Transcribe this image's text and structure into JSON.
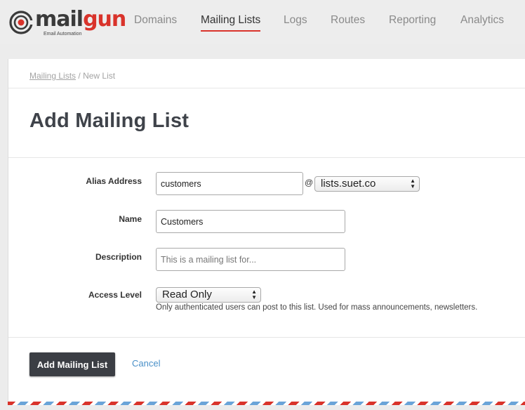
{
  "brand": {
    "name_dark": "mail",
    "name_red": "gun",
    "tagline": "Email Automation",
    "accent_color": "#d9332b"
  },
  "nav": {
    "items": [
      {
        "label": "Domains"
      },
      {
        "label": "Mailing Lists",
        "active": true
      },
      {
        "label": "Logs"
      },
      {
        "label": "Routes"
      },
      {
        "label": "Reporting"
      },
      {
        "label": "Analytics"
      }
    ]
  },
  "breadcrumb": {
    "parent": "Mailing Lists",
    "separator": "/",
    "current": "New List"
  },
  "page": {
    "title": "Add Mailing List"
  },
  "form": {
    "alias": {
      "label": "Alias Address",
      "value": "customers",
      "at_symbol": "@",
      "domain_selected": "lists.suet.co"
    },
    "name": {
      "label": "Name",
      "value": "Customers"
    },
    "description": {
      "label": "Description",
      "placeholder": "This is a mailing list for..."
    },
    "access_level": {
      "label": "Access Level",
      "selected": "Read Only",
      "help": "Only authenticated users can post to this list. Used for mass announcements, newsletters."
    }
  },
  "actions": {
    "submit_label": "Add Mailing List",
    "cancel_label": "Cancel"
  }
}
